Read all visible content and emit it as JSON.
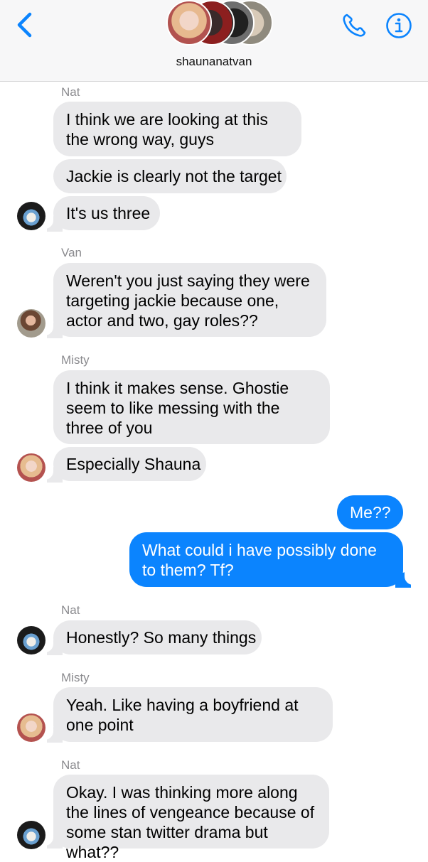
{
  "header": {
    "back_icon": "chevron-left-icon",
    "group_name": "shaunanatvan",
    "group_avatars": [
      "group-avatar-1",
      "group-avatar-2",
      "group-avatar-3",
      "group-avatar-4"
    ],
    "call_icon": "phone-icon",
    "info_icon": "info-icon",
    "accent_color": "#0b84fe"
  },
  "messages": [
    {
      "sender": "Nat"
    },
    {
      "text": "I think we are looking at this the wrong way, guys"
    },
    {
      "text": "Jackie is clearly not the target"
    },
    {
      "text": "It's us three"
    },
    {
      "sender": "Van"
    },
    {
      "text": "Weren't you just saying they were targeting jackie because one, actor and two, gay roles??"
    },
    {
      "sender": "Misty"
    },
    {
      "text": "I think it makes sense. Ghostie seem to like messing with the three of you"
    },
    {
      "text": "Especially Shauna"
    },
    {
      "text": "Me??"
    },
    {
      "text": "What could i have possibly done to them? Tf?"
    },
    {
      "sender": "Nat"
    },
    {
      "text": "Honestly? So many things"
    },
    {
      "sender": "Misty"
    },
    {
      "text": "Yeah. Like having a boyfriend at one point"
    },
    {
      "sender": "Nat"
    },
    {
      "text": "Okay. I was thinking more along the lines of vengeance because of some stan twitter drama but what??"
    }
  ],
  "colors": {
    "incoming_bubble": "#e9e9eb",
    "outgoing_bubble": "#0b84fe",
    "sender_label": "#8a8a8e"
  }
}
